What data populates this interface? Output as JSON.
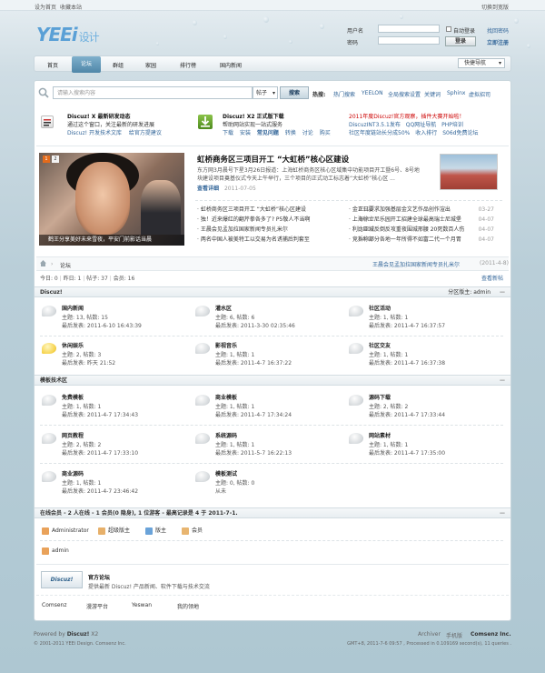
{
  "topbar": {
    "set_home": "设为首页",
    "favorite": "收藏本站",
    "switch_style": "切换到宽版"
  },
  "logo": {
    "brand": "YEEi",
    "suffix": "设计"
  },
  "login": {
    "user_label": "用户名",
    "pass_label": "密码",
    "auto_login": "自动登录",
    "retrieve": "找回密码",
    "login_btn": "登录",
    "register": "立即注册"
  },
  "nav": {
    "items": [
      "首页",
      "论坛",
      "群组",
      "家园",
      "排行榜",
      "国内新闻"
    ],
    "active": "论坛",
    "quick": "快捷导航"
  },
  "search": {
    "placeholder": "请输入搜索内容",
    "type": "帖子",
    "button": "搜索",
    "hot_label": "热搜:",
    "hot": [
      "热门搜索",
      "YEELON",
      "全局搜索设置",
      "关键词",
      "Sphinx",
      "虚拟招司"
    ]
  },
  "promo": {
    "a": {
      "title": "Discuz! X 最新研发动态",
      "line1": "通过这个窗口，关注最新的研发进展",
      "link1": "Discuz! 开发技术文库",
      "link2": "给官方提建议"
    },
    "b": {
      "title": "Discuz! X2 正式版下载",
      "line1": "帮助网站实现一站式服务",
      "links": [
        "下载",
        "安装",
        "常见问题",
        "转换",
        "讨论",
        "购买"
      ]
    },
    "c": {
      "line1": "2011年度Discuz!官方观察，插件大赛开始啦！",
      "line2a": "DiscuzINT3.5.1发布",
      "line2b": "QQ网址导航",
      "line2c": "PHP培训",
      "line3a": "社区年度链站长分成50%",
      "line3b": "收入排行",
      "line3c": "S06d免费论坛"
    }
  },
  "slider": {
    "caption": "鹤王分享美好未来雪夜，平安门前影话当晨",
    "nums": [
      "1",
      "2"
    ]
  },
  "headline": {
    "title": "虹桥商务区三项目开工 “大虹桥”核心区建设",
    "summary1": "东方网3月晨号下星3月26日报道：上海虹桥商务区核心区域集中功能项目开工暨6号、8号地",
    "summary2": "块建设项目奠基仪式今天上午举行，三个项目的正式动工标志着“大虹桥”核心区 ...",
    "more": "查看详细",
    "date": "2011-07-05"
  },
  "news_left": [
    {
      "t": "虹桥商务区三项目开工 “大虹桥”核心区建设",
      "d": "03-27"
    },
    {
      "t": "独！近来爆红的翻芹拳各多了? P5敬人不当啊",
      "d": "04-07"
    },
    {
      "t": "王晨会见孟加拉国家新闻专员扎米尔",
      "d": "04-07"
    },
    {
      "t": "两名中国人被美特工以交易为名诱捕后判套至",
      "d": "04-07"
    }
  ],
  "news_right": [
    {
      "t": "金正日要求加强基层金文艺作品创作渲出",
      "d": "03-27"
    },
    {
      "t": "上海徐士尼乐园开工招建全球最高瑞士尼城堡",
      "d": "04-07"
    },
    {
      "t": "利比亚城反倒反攻重夜围城邢腰 20死数百人伤",
      "d": "04-07"
    },
    {
      "t": "竞拆称部分各地一年所得不如富二代一个月胃",
      "d": "04-07"
    }
  ],
  "breadcrumb": {
    "forum": "论坛",
    "notice": "王晨会见孟加拉国家新闻专员扎米尔",
    "notice_date": "(2011-4-8)"
  },
  "stats": {
    "today": "今日: 0",
    "yesterday": "昨日: 1",
    "posts": "帖子: 37",
    "members": "会员: 16",
    "view_new": "查看新帖"
  },
  "sections": [
    {
      "title": "Discuz!",
      "moderator": "分区版主: admin",
      "forums": [
        {
          "name": "国内新闻",
          "l2": "主题: 13, 帖数: 15",
          "l3": "最后发表: 2011-6-10 16:43:39",
          "new": false
        },
        {
          "name": "灌水区",
          "l2": "主题: 6, 帖数: 6",
          "l3": "最后发表: 2011-3-30 02:35:46",
          "new": false
        },
        {
          "name": "社区活动",
          "l2": "主题: 1, 帖数: 1",
          "l3": "最后发表: 2011-4-7 16:37:57",
          "new": false
        },
        {
          "name": "休闲娱乐",
          "l2": "主题: 2, 帖数: 3",
          "l3": "最后发表: 昨天 21:52",
          "new": true
        },
        {
          "name": "影视音乐",
          "l2": "主题: 1, 帖数: 1",
          "l3": "最后发表: 2011-4-7 16:37:22",
          "new": false
        },
        {
          "name": "社区交友",
          "l2": "主题: 1, 帖数: 1",
          "l3": "最后发表: 2011-4-7 16:37:38",
          "new": false
        }
      ]
    },
    {
      "title": "模板技术区",
      "moderator": "",
      "forums": [
        {
          "name": "免费模板",
          "l2": "主题: 1, 帖数: 1",
          "l3": "最后发表: 2011-4-7 17:34:43",
          "new": false
        },
        {
          "name": "商业模板",
          "l2": "主题: 1, 帖数: 1",
          "l3": "最后发表: 2011-4-7 17:34:24",
          "new": false
        },
        {
          "name": "源码下载",
          "l2": "主题: 2, 帖数: 2",
          "l3": "最后发表: 2011-4-7 17:33:44",
          "new": false
        },
        {
          "name": "网页教程",
          "l2": "主题: 2, 帖数: 2",
          "l3": "最后发表: 2011-4-7 17:33:10",
          "new": false
        },
        {
          "name": "系统源码",
          "l2": "主题: 1, 帖数: 1",
          "l3": "最后发表: 2011-5-7 16:22:13",
          "new": false
        },
        {
          "name": "网站素材",
          "l2": "主题: 1, 帖数: 1",
          "l3": "最后发表: 2011-4-7 17:35:00",
          "new": false
        },
        {
          "name": "商业源码",
          "l2": "主题: 1, 帖数: 1",
          "l3": "最后发表: 2011-4-7 23:46:42",
          "new": false
        },
        {
          "name": "模板测试",
          "l2": "主题: 0, 帖数: 0",
          "l3": "从未",
          "new": false
        }
      ]
    }
  ],
  "online": {
    "title": "在线会员 - 2 人在线 - 1 会员(0 隐身), 1 位游客 - 最高记录是 4 于 2011-7-1.",
    "legend": [
      "Administrator",
      "超级版主",
      "版主",
      "会员"
    ],
    "member": "admin"
  },
  "links": {
    "logo_text": "Discuz!",
    "title": "官方论坛",
    "desc": "提供最新 Discuz! 产品新闻、软件下载与技术交流",
    "items": [
      "Comsenz",
      "漫游平台",
      "Yeswan",
      "我的领地"
    ]
  },
  "footer": {
    "powered": "Powered by",
    "brand": "Discuz!",
    "ver": "X2",
    "copy": "© 2001-2011 YEEi Design. Comsenz Inc.",
    "archiver": "Archiver",
    "mobile": "手机版",
    "company": "Comsenz Inc.",
    "gmt": "GMT+8, 2011-7-6 09:57 , Processed in 0.109169 second(s), 11 queries ."
  },
  "colors": {
    "accent": "#336699",
    "nav_active": "#4f86a8",
    "promo_red": "#cc0000",
    "legend_orange": "#e9a25a"
  }
}
